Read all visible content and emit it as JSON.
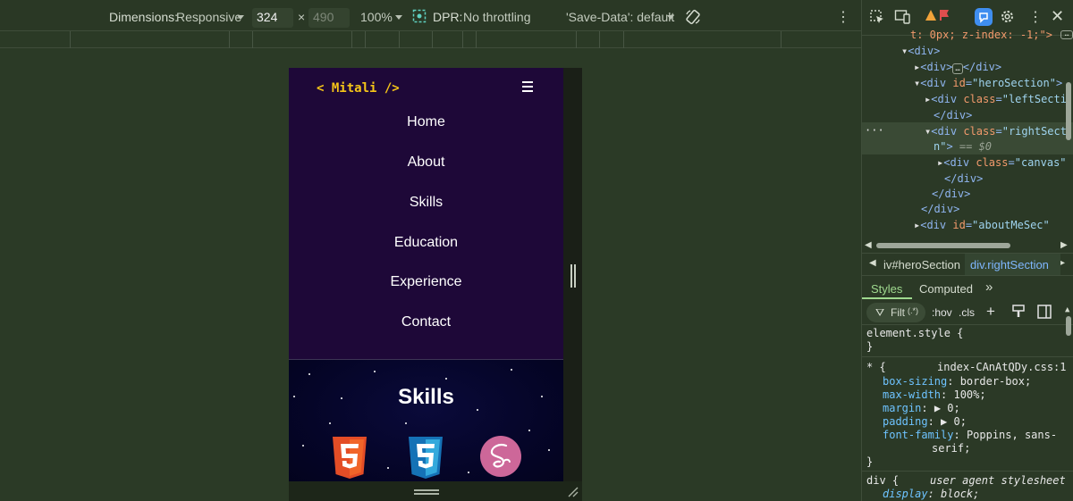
{
  "toolbar": {
    "dimensions_label": "Dimensions:",
    "dimensions_value": "Responsive",
    "width": "324",
    "times": "×",
    "height": "490",
    "zoom": "100%",
    "dpr_label": "DPR:",
    "throttling": "No throttling",
    "save_data": "'Save-Data': default"
  },
  "device_page": {
    "logo": "< Mitali />",
    "menu": [
      "Home",
      "About",
      "Skills",
      "Education",
      "Experience",
      "Contact"
    ],
    "skills_title": "Skills",
    "skill_icons": [
      "html5-icon",
      "css3-icon",
      "sass-icon"
    ],
    "colors": {
      "nav_bg": "#1e0838",
      "logo": "#f5c518",
      "html5": "#e44d26",
      "css3": "#1572b6",
      "sass": "#cd6799"
    }
  },
  "devtools": {
    "elements": {
      "l0": "t: 0px; z-index: -1;\">",
      "l1": "<div>",
      "l2_open": "<div>",
      "l2_close": "</div>",
      "l3_tag": "<div ",
      "l3_attr": "id",
      "l3_val": "\"heroSection\"",
      "l4_tag": "<div ",
      "l4_attr": "class",
      "l4_val": "\"leftSecti",
      "l5": "</div>",
      "l6_tag": "<div ",
      "l6_attr": "class",
      "l6_val": "\"rightSect",
      "l7_val": "n\"",
      "l7_rest": "== $0",
      "l8_tag": "<div ",
      "l8_attr": "class",
      "l8_val": "\"canvas\"",
      "l9": "</div>",
      "l10": "</div>",
      "l11": "</div>",
      "l12_tag": "<div ",
      "l12_attr": "id",
      "l12_val": "\"aboutMeSec\""
    },
    "breadcrumb": [
      "iv#heroSection",
      "div.rightSection"
    ],
    "tabs": [
      "Styles",
      "Computed"
    ],
    "filter_placeholder": "Filt",
    "filter_regex": "(.*)",
    "hov": ":hov",
    "cls": ".cls",
    "styles": {
      "element_style": "element.style {",
      "close1": "}",
      "universal_selector": "* {",
      "source": "index-CAnAtQDy.css:1",
      "rules": [
        {
          "prop": "box-sizing",
          "value": "border-box;"
        },
        {
          "prop": "max-width",
          "value": "100%;"
        },
        {
          "prop": "margin",
          "value": "▶ 0;"
        },
        {
          "prop": "padding",
          "value": "▶ 0;"
        },
        {
          "prop": "font-family",
          "value": "Poppins, sans-"
        },
        {
          "prop": "",
          "value": "serif;"
        }
      ],
      "close2": "}",
      "div_selector": "div {",
      "ua_note": "user agent stylesheet",
      "div_prop": "display",
      "div_val": "block;"
    }
  }
}
